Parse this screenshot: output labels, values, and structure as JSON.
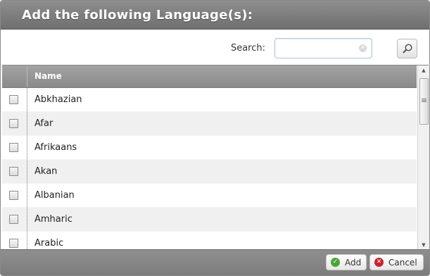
{
  "dialog": {
    "title": "Add the following Language(s):"
  },
  "search": {
    "label": "Search:",
    "value": "",
    "placeholder": ""
  },
  "grid": {
    "columns": [
      "",
      "Name"
    ],
    "rows": [
      {
        "name": "Abkhazian",
        "checked": false
      },
      {
        "name": "Afar",
        "checked": false
      },
      {
        "name": "Afrikaans",
        "checked": false
      },
      {
        "name": "Akan",
        "checked": false
      },
      {
        "name": "Albanian",
        "checked": false
      },
      {
        "name": "Amharic",
        "checked": false
      },
      {
        "name": "Arabic",
        "checked": false
      }
    ]
  },
  "footer": {
    "add_label": "Add",
    "cancel_label": "Cancel"
  },
  "icons": {
    "search": "magnifier-icon",
    "clear": "clear-icon",
    "add": "check-circle-icon",
    "cancel": "x-circle-icon"
  },
  "colors": {
    "title_bar": "#7f7f7f",
    "header": "#949494",
    "add_icon": "#49a53a",
    "cancel_icon": "#c8222c"
  }
}
